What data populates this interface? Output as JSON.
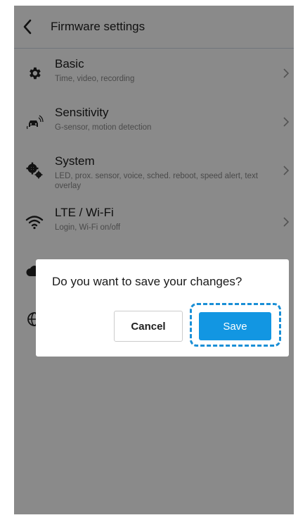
{
  "header": {
    "title": "Firmware settings"
  },
  "menu": [
    {
      "label": "Basic",
      "desc": "Time, video, recording",
      "icon": "gear-icon"
    },
    {
      "label": "Sensitivity",
      "desc": "G-sensor, motion detection",
      "icon": "car-motion-icon"
    },
    {
      "label": "System",
      "desc": "LED, prox. sensor, voice, sched. reboot, speed alert, text overlay",
      "icon": "gears-icon"
    },
    {
      "label": "LTE / Wi-Fi",
      "desc": "Login, Wi-Fi on/off",
      "icon": "wifi-icon"
    }
  ],
  "hidden_items": [
    {
      "icon": "cloud-icon"
    },
    {
      "icon": "globe-icon"
    }
  ],
  "dialog": {
    "message": "Do you want to save your changes?",
    "cancel_label": "Cancel",
    "save_label": "Save"
  },
  "colors": {
    "accent": "#1296e2",
    "highlight": "#1a8fd6",
    "overlay": "rgba(0,0,0,0.46)"
  }
}
